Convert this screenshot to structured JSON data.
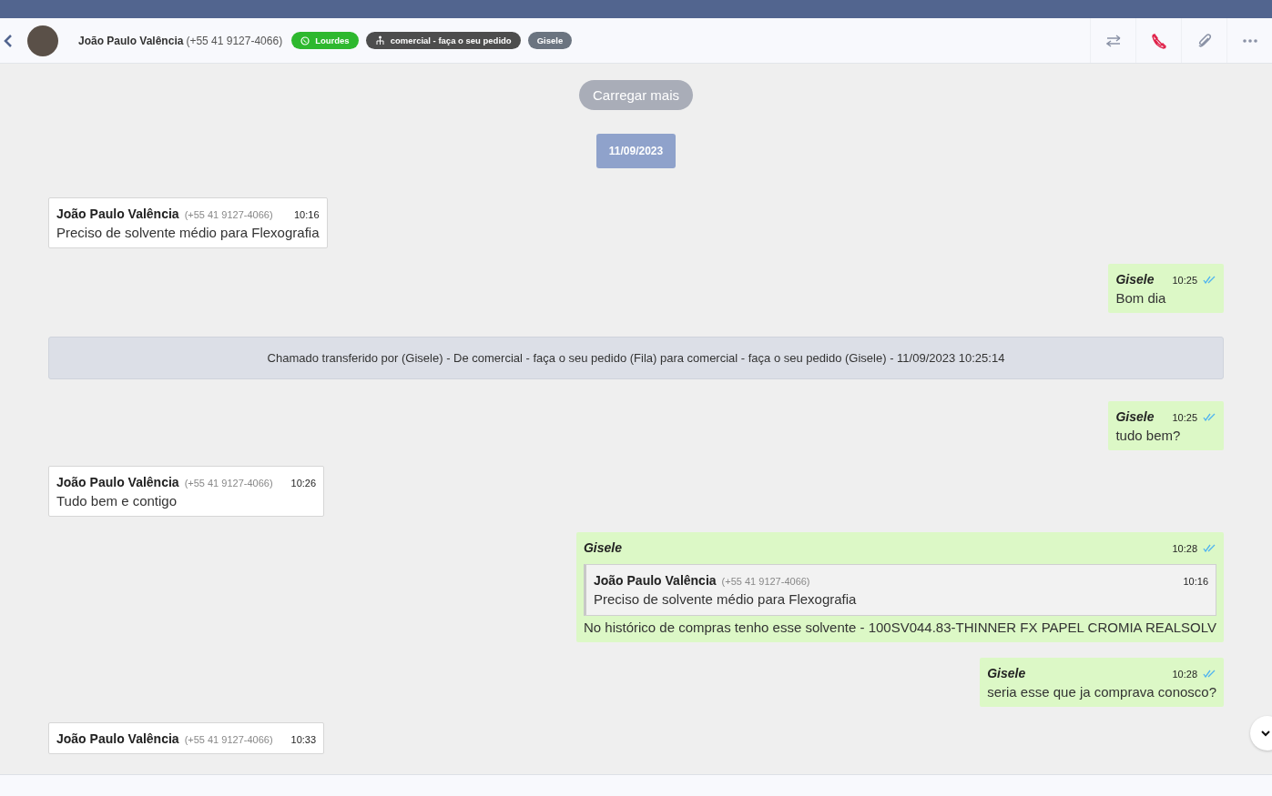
{
  "contact": {
    "name": "João Paulo Valência",
    "phone": "(+55 41 9127-4066)"
  },
  "tags": [
    {
      "label": "Lourdes",
      "kind": "whatsapp",
      "color": "#2eb82e"
    },
    {
      "label": "comercial - faça o seu pedido",
      "kind": "queue",
      "color": "#4d4d4d"
    },
    {
      "label": "Gisele",
      "kind": "plain",
      "color": "#6b7480"
    }
  ],
  "load_more": "Carregar mais",
  "date": "11/09/2023",
  "messages": [
    {
      "kind": "incoming",
      "author": "João Paulo Valência",
      "phone": "(+55 41 9127-4066)",
      "time": "10:16",
      "text": "Preciso de solvente médio para Flexografia"
    },
    {
      "kind": "outgoing",
      "author": "Gisele",
      "time": "10:25",
      "read": true,
      "text": "Bom dia"
    },
    {
      "kind": "system",
      "text": "Chamado transferido por (Gisele) - De comercial - faça o seu pedido (Fila) para comercial - faça o seu pedido (Gisele) - 11/09/2023 10:25:14"
    },
    {
      "kind": "outgoing",
      "author": "Gisele",
      "time": "10:25",
      "read": true,
      "text": "tudo bem?"
    },
    {
      "kind": "incoming",
      "author": "João Paulo Valência",
      "phone": "(+55 41 9127-4066)",
      "time": "10:26",
      "text": "Tudo bem e contigo"
    },
    {
      "kind": "outgoing",
      "author": "Gisele",
      "time": "10:28",
      "read": true,
      "quote": {
        "author": "João Paulo Valência",
        "phone": "(+55 41 9127-4066)",
        "time": "10:16",
        "text": "Preciso de solvente médio para Flexografia"
      },
      "text": "No histórico de compras tenho esse solvente - 100SV044.83-THINNER FX PAPEL CROMIA REALSOLV"
    },
    {
      "kind": "outgoing",
      "author": "Gisele",
      "time": "10:28",
      "read": true,
      "text": "seria esse que ja comprava conosco?"
    },
    {
      "kind": "incoming",
      "author": "João Paulo Valência",
      "phone": "(+55 41 9127-4066)",
      "time": "10:33"
    }
  ]
}
